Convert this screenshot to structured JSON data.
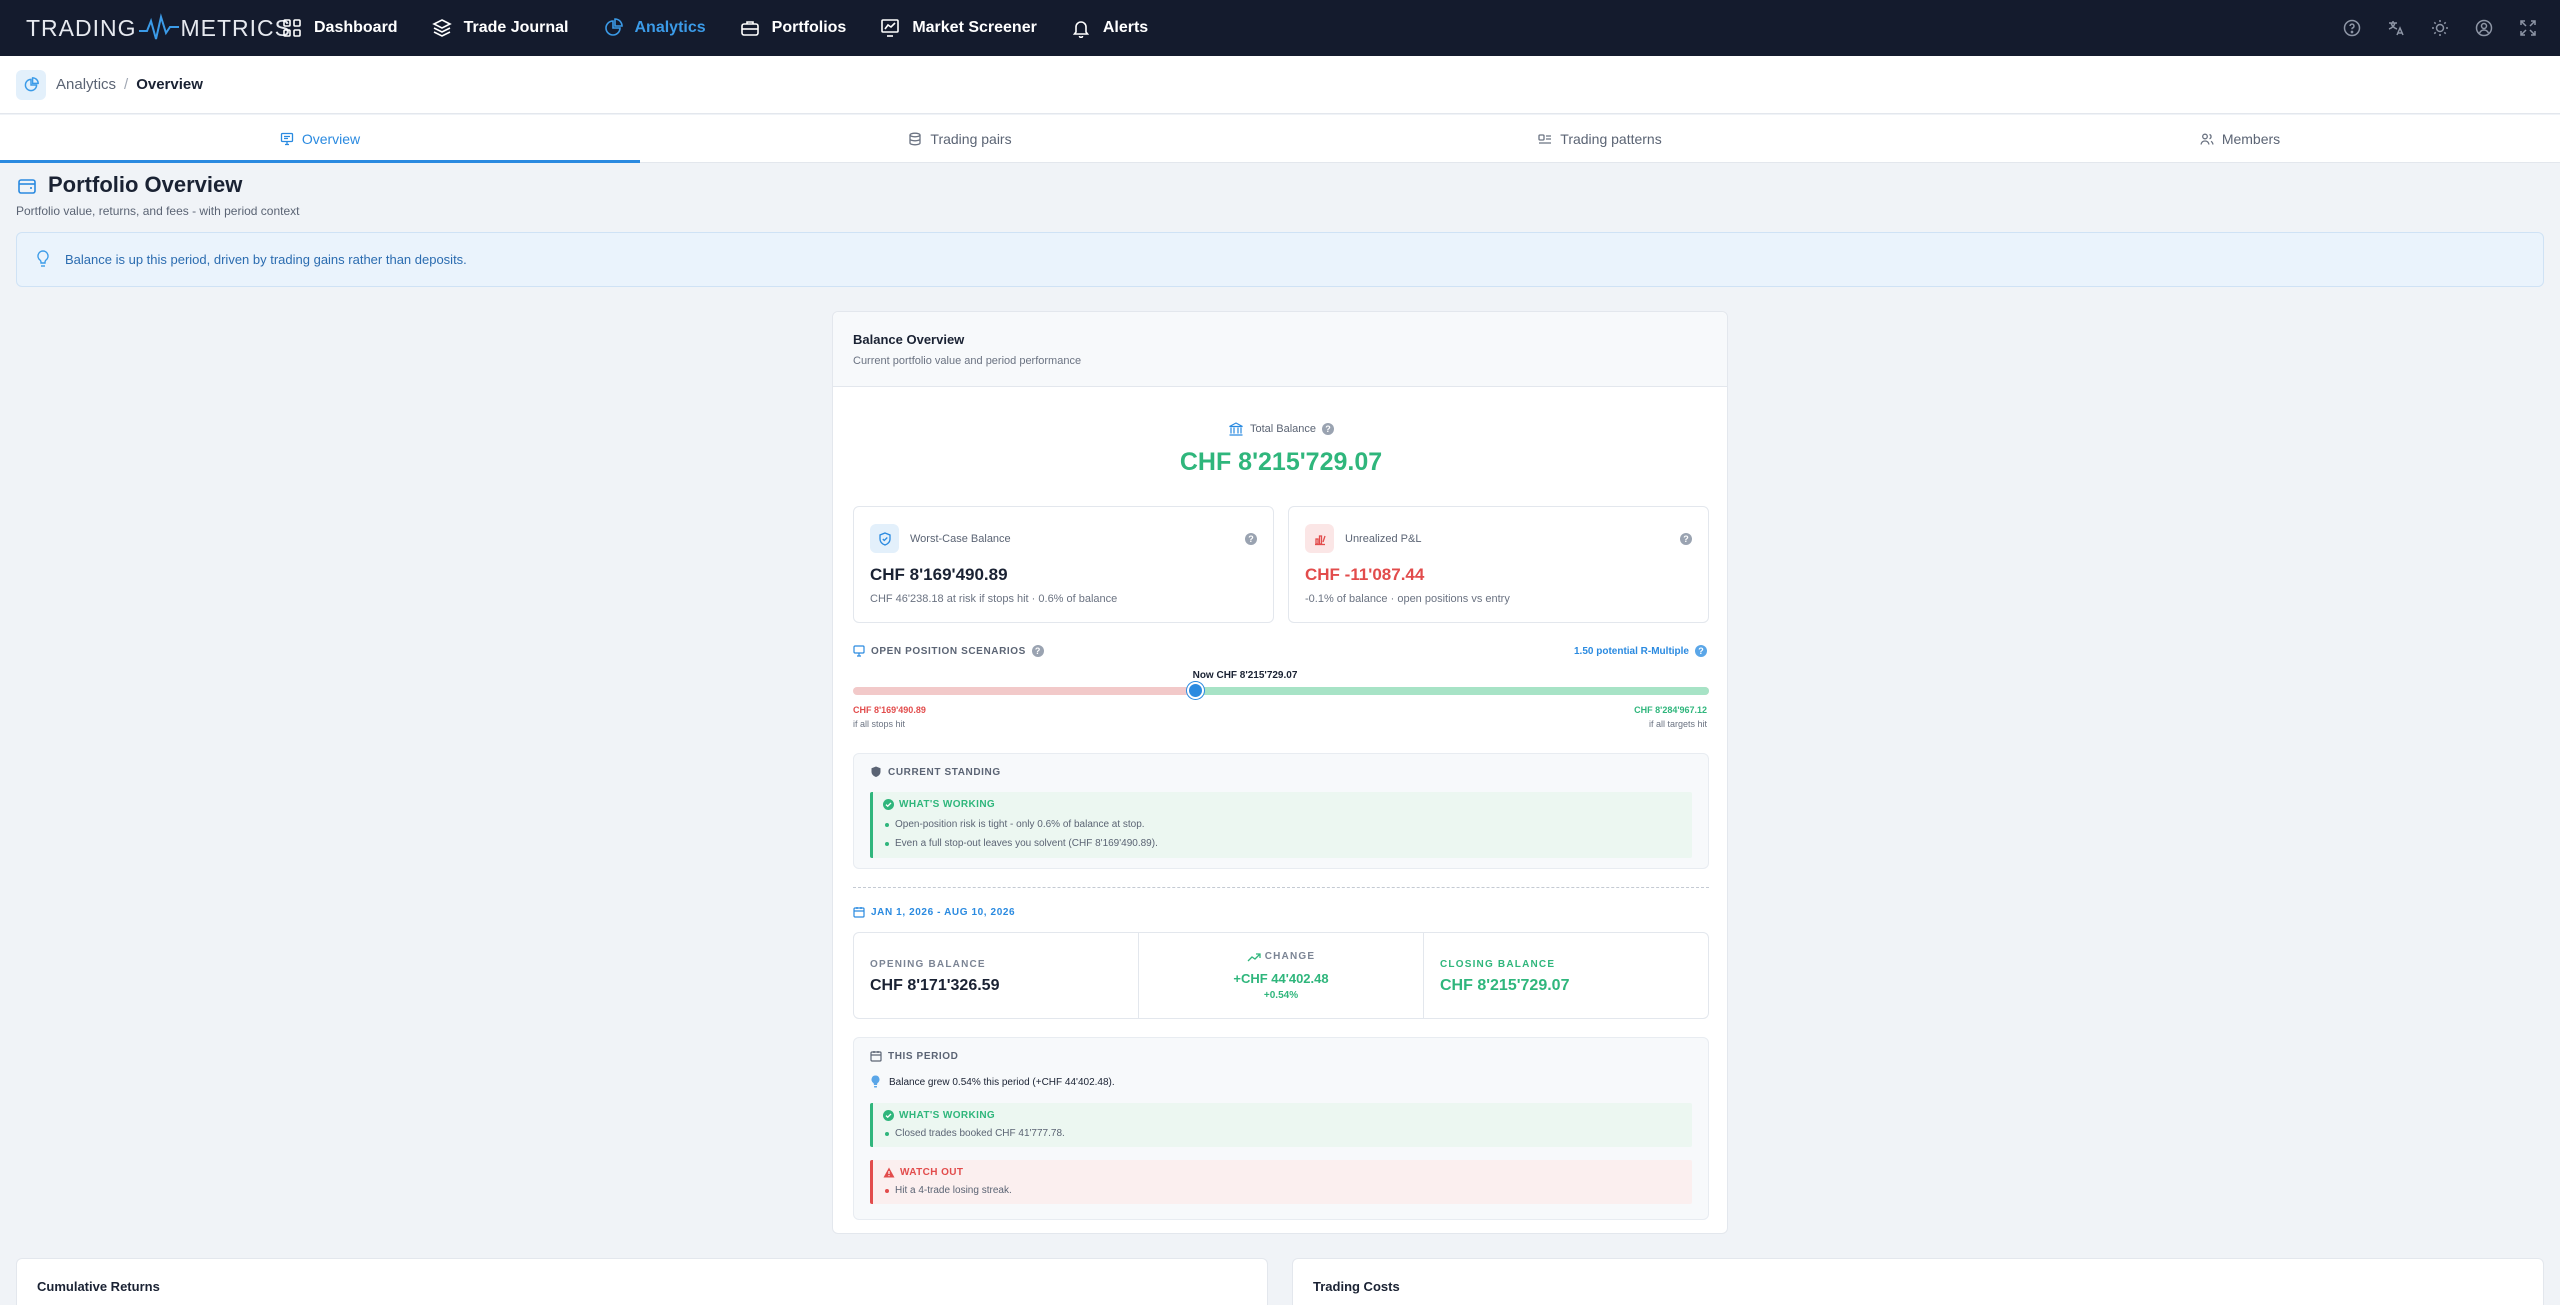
{
  "app": {
    "logo_left": "TRADING",
    "logo_right": "METRICS"
  },
  "nav": [
    {
      "label": "Dashboard",
      "icon": "grid-icon"
    },
    {
      "label": "Trade Journal",
      "icon": "layers-icon"
    },
    {
      "label": "Analytics",
      "icon": "pie-chart-icon",
      "active": true
    },
    {
      "label": "Portfolios",
      "icon": "briefcase-icon"
    },
    {
      "label": "Market Screener",
      "icon": "chart-screen-icon"
    },
    {
      "label": "Alerts",
      "icon": "bell-icon"
    }
  ],
  "top_icons": [
    "help-circle-icon",
    "translate-icon",
    "sun-icon",
    "user-circle-icon",
    "fullscreen-icon"
  ],
  "breadcrumb": {
    "parent": "Analytics",
    "separator": "/",
    "current": "Overview"
  },
  "tabs": [
    {
      "label": "Overview",
      "icon": "board-icon",
      "active": true
    },
    {
      "label": "Trading pairs",
      "icon": "database-icon"
    },
    {
      "label": "Trading patterns",
      "icon": "pattern-icon"
    },
    {
      "label": "Members",
      "icon": "users-icon"
    }
  ],
  "page": {
    "title": "Portfolio Overview",
    "subtitle": "Portfolio value, returns, and fees - with period context",
    "insight": "Balance is up this period, driven by trading gains rather than deposits."
  },
  "balance_card": {
    "title": "Balance Overview",
    "subtitle": "Current portfolio value and period performance",
    "total_label": "Total Balance",
    "total_value": "CHF 8'215'729.07",
    "worst_case": {
      "label": "Worst-Case Balance",
      "value": "CHF 8'169'490.89",
      "sub": "CHF 46'238.18 at risk if stops hit · 0.6% of balance"
    },
    "unrealized": {
      "label": "Unrealized P&L",
      "value": "CHF -11'087.44",
      "sub": "-0.1% of balance · open positions vs entry"
    },
    "scenarios": {
      "label": "OPEN POSITION SCENARIOS",
      "r_multiple": "1.50 potential R-Multiple",
      "now_label": "Now CHF 8'215'729.07",
      "now_position": 0.4,
      "low_value": "CHF 8'169'490.89",
      "low_caption": "if all stops hit",
      "high_value": "CHF 8'284'967.12",
      "high_caption": "if all targets hit"
    },
    "standing": {
      "label": "CURRENT STANDING",
      "working_title": "WHAT'S WORKING",
      "items": [
        "Open-position risk is tight - only 0.6% of balance at stop.",
        "Even a full stop-out leaves you solvent (CHF 8'169'490.89)."
      ]
    },
    "period": {
      "range": "JAN 1, 2026 - AUG 10, 2026",
      "opening_label": "OPENING BALANCE",
      "opening_value": "CHF 8'171'326.59",
      "change_label": "CHANGE",
      "change_value": "+CHF 44'402.48",
      "change_pct": "+0.54%",
      "closing_label": "CLOSING BALANCE",
      "closing_value": "CHF 8'215'729.07"
    },
    "this_period": {
      "label": "THIS PERIOD",
      "summary": "Balance grew 0.54% this period (+CHF 44'402.48).",
      "working_title": "WHAT'S WORKING",
      "working_items": [
        "Closed trades booked CHF 41'777.78."
      ],
      "watch_title": "WATCH OUT",
      "watch_items": [
        "Hit a 4-trade losing streak."
      ]
    }
  },
  "bottom_cards": {
    "left_title": "Cumulative Returns",
    "right_title": "Trading Costs"
  },
  "colors": {
    "accent": "#2a8ae0",
    "positive": "#2fb67c",
    "negative": "#e24c4c",
    "topbar": "#141b2d"
  }
}
